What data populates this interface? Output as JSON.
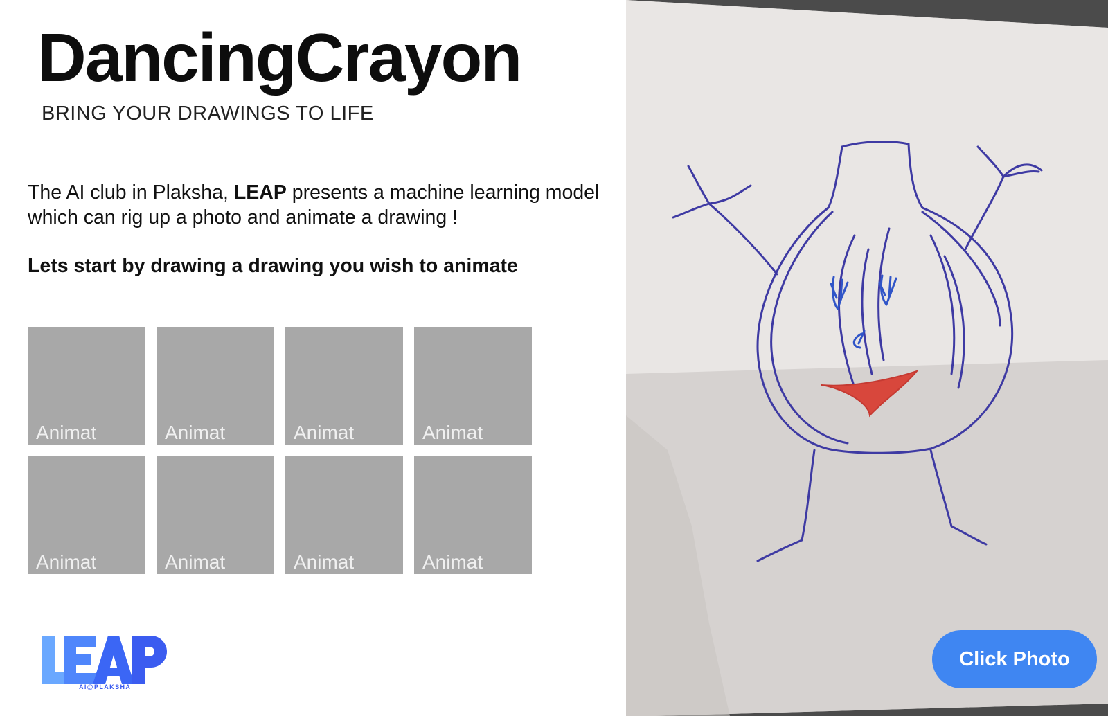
{
  "app": {
    "title": "DancingCrayon",
    "subtitle": "BRING YOUR DRAWINGS TO LIFE"
  },
  "intro": {
    "text_before": "The AI club in Plaksha, ",
    "club_name": "LEAP",
    "text_after": " presents a machine learning model which can rig up a photo and animate a drawing !"
  },
  "instruction": "Lets start by drawing a drawing you wish to animate",
  "tiles": [
    {
      "label": "Animat"
    },
    {
      "label": "Animat"
    },
    {
      "label": "Animat"
    },
    {
      "label": "Animat"
    },
    {
      "label": "Animat"
    },
    {
      "label": "Animat"
    },
    {
      "label": "Animat"
    },
    {
      "label": "Animat"
    }
  ],
  "logo": {
    "text": "LEAP",
    "caption": "AI@PLAKSHA"
  },
  "camera": {
    "button_label": "Click Photo"
  },
  "colors": {
    "accent": "#3f86f2",
    "tile": "#a8a8a8",
    "logo_blue": "#3b5cf0",
    "logo_light_blue": "#6aa8ff"
  }
}
